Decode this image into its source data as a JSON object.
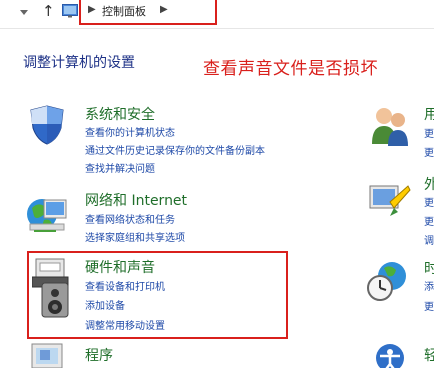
{
  "address_bar": {
    "breadcrumb": "控制面板",
    "icons": [
      "back-arrow-icon",
      "up-arrow-icon",
      "control-panel-icon",
      "chevron-right-icon"
    ]
  },
  "page": {
    "title": "调整计算机的设置",
    "annotation": "查看声音文件是否损坏"
  },
  "sections": [
    {
      "title": "系统和安全",
      "icon": "shield-icon",
      "links": [
        "查看你的计算机状态",
        "通过文件历史记录保存你的文件备份副本",
        "查找并解决问题"
      ]
    },
    {
      "title": "网络和 Internet",
      "icon": "network-globe-icon",
      "links": [
        "查看网络状态和任务",
        "选择家庭组和共享选项"
      ]
    },
    {
      "title": "硬件和声音",
      "icon": "printer-speaker-icon",
      "links": [
        "查看设备和打印机",
        "添加设备",
        "调整常用移动设置"
      ]
    },
    {
      "title": "程序",
      "icon": "programs-icon",
      "links": []
    }
  ],
  "right_column": {
    "items": [
      {
        "title": "用",
        "lines": [
          "更",
          "更"
        ]
      },
      {
        "title": "外",
        "lines": [
          "更",
          "更",
          "调"
        ]
      },
      {
        "title": "时",
        "lines": [
          "添",
          "更"
        ]
      },
      {
        "title": "轻",
        "lines": []
      }
    ]
  },
  "colors": {
    "link": "#1f4aa8",
    "section_title": "#1f6e2a",
    "page_title": "#1e3287",
    "highlight": "#d9201c"
  }
}
